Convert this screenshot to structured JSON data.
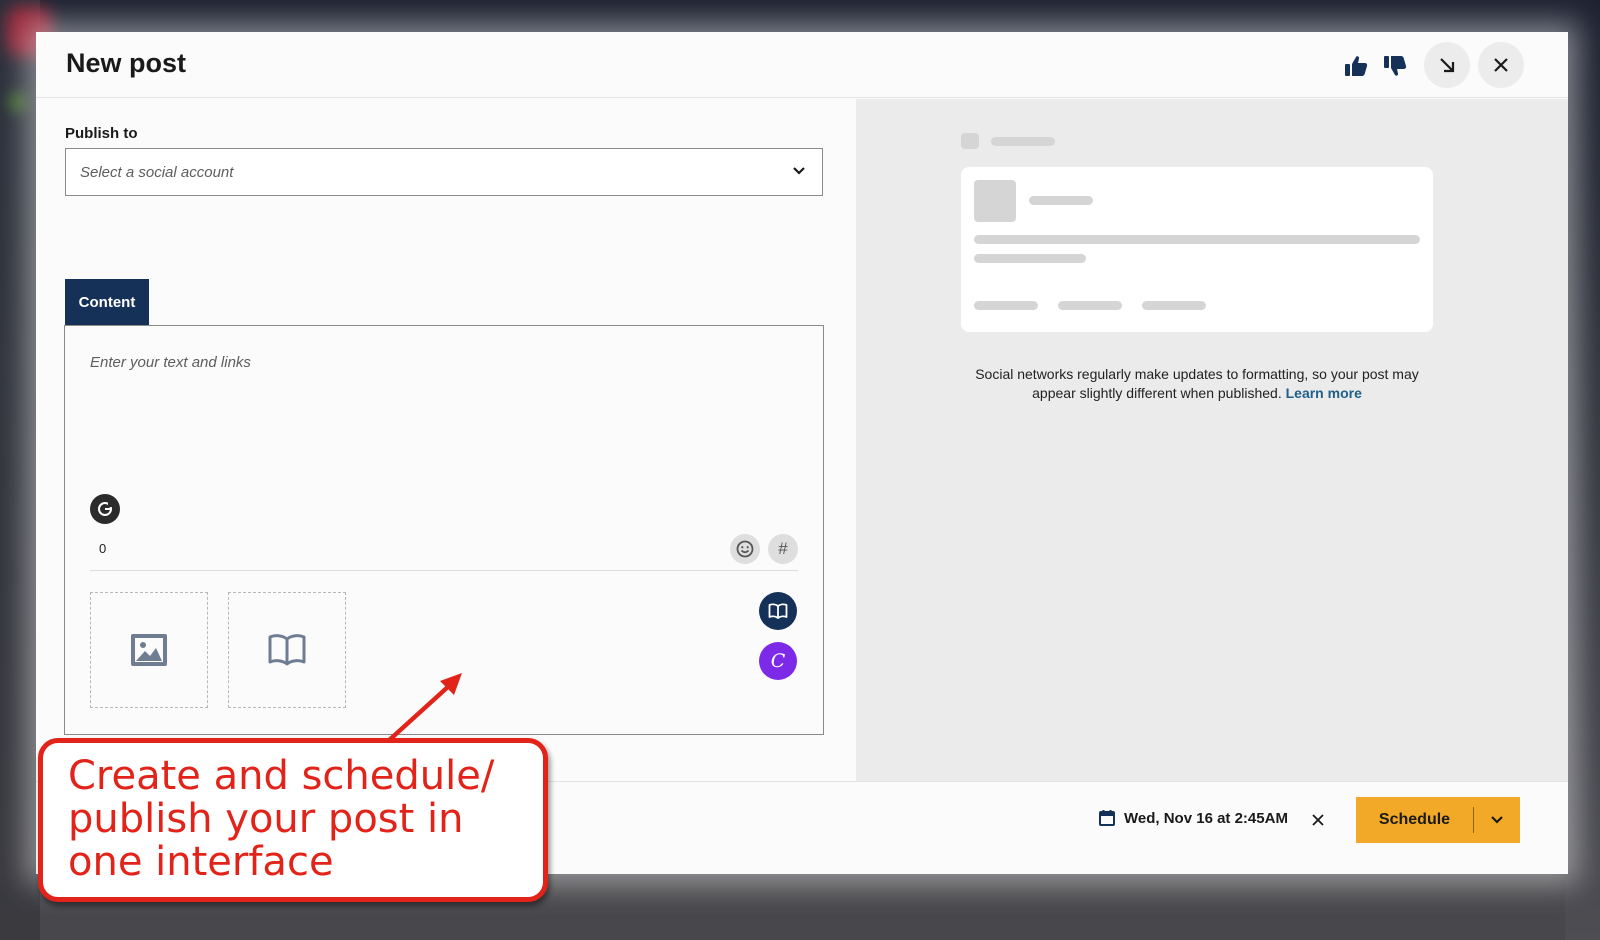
{
  "modal": {
    "title": "New post",
    "header_icons": [
      "thumbs-up-icon",
      "thumbs-down-icon",
      "minimize-icon",
      "close-icon"
    ]
  },
  "publish": {
    "label": "Publish to",
    "placeholder": "Select a social account"
  },
  "composer": {
    "tab_label": "Content",
    "placeholder": "Enter your text and links",
    "char_count": "0",
    "hash_symbol": "#",
    "canva_letter": "C"
  },
  "preview": {
    "note": "Social networks regularly make updates to formatting, so your post may appear slightly different when published. ",
    "link": "Learn more"
  },
  "footer": {
    "date": "Wed, Nov 16 at 2:45AM",
    "schedule_label": "Schedule"
  },
  "callout": {
    "text": "Create and schedule/ publish your post in one interface"
  },
  "colors": {
    "navy": "#163158",
    "schedule": "#f3a928",
    "canva": "#7d2ae8",
    "callout_red": "#e2231a",
    "link": "#1f5f8b"
  }
}
